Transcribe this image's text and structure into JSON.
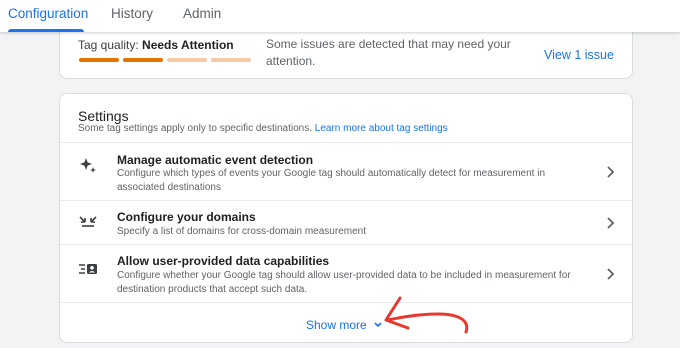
{
  "tabs": [
    {
      "label": "Configuration",
      "active": true
    },
    {
      "label": "History",
      "active": false
    },
    {
      "label": "Admin",
      "active": false
    }
  ],
  "quality": {
    "label_prefix": "Tag quality: ",
    "status": "Needs Attention",
    "segments": [
      {
        "filled": true,
        "color": "#e37400"
      },
      {
        "filled": true,
        "color": "#e37400"
      },
      {
        "filled": false,
        "color": "#f6cba4"
      },
      {
        "filled": false,
        "color": "#f6cba4"
      }
    ],
    "description": "Some issues are detected that may need your attention.",
    "action_label": "View 1 issue"
  },
  "settings": {
    "title": "Settings",
    "subtitle_text": "Some tag settings apply only to specific destinations. ",
    "subtitle_link": "Learn more about tag settings",
    "rows": [
      {
        "icon": "sparkle-icon",
        "title": "Manage automatic event detection",
        "description": "Configure which types of events your Google tag should automatically detect for measurement in associated destinations"
      },
      {
        "icon": "arrows-inward-icon",
        "title": "Configure your domains",
        "description": "Specify a list of domains for cross-domain measurement"
      },
      {
        "icon": "user-data-icon",
        "title": "Allow user-provided data capabilities",
        "description": "Configure whether your Google tag should allow user-provided data to be included in measurement for destination products that accept such data."
      }
    ],
    "show_more_label": "Show more"
  },
  "colors": {
    "accent": "#1a73e8",
    "annotation": "#e8392f"
  }
}
